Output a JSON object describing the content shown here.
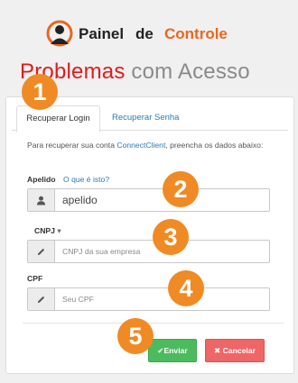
{
  "header": {
    "brand_word_1": "Painel",
    "brand_word_2": "de",
    "brand_word_3": "Controle",
    "logo_icon": "user-target-logo-icon"
  },
  "page": {
    "title_part_1": "Problemas",
    "title_part_2": "com Acesso"
  },
  "tabs": [
    {
      "label": "Recuperar Login",
      "active": true
    },
    {
      "label": "Recuperar Senha",
      "active": false
    }
  ],
  "form": {
    "info_text_before": "Para recuperar sua conta ",
    "info_link": "ConnectClient",
    "info_text_after": ", preencha os dados abaixo:",
    "apelido_label": "Apelido",
    "apelido_help_link": "O que é isto?",
    "apelido_value": "apelido",
    "doc_type_label": "CNPJ",
    "doc_type_caret": "▾",
    "cnpj_placeholder": "CNPJ da sua empresa",
    "cpf_label": "CPF",
    "cpf_placeholder": "Seu CPF"
  },
  "buttons": {
    "submit_label": "Enviar",
    "submit_icon": "✔",
    "cancel_label": "Cancelar",
    "cancel_icon": "✖"
  },
  "annotations": [
    "1",
    "2",
    "3",
    "4",
    "5"
  ],
  "colors": {
    "brand_orange": "#e8681e",
    "title_red": "#e01b1b",
    "title_grey": "#8a8a8a",
    "link_blue": "#2a7ab8",
    "submit_green": "#4cbb5e",
    "cancel_red": "#ee6666",
    "badge_orange": "#f08a24"
  }
}
